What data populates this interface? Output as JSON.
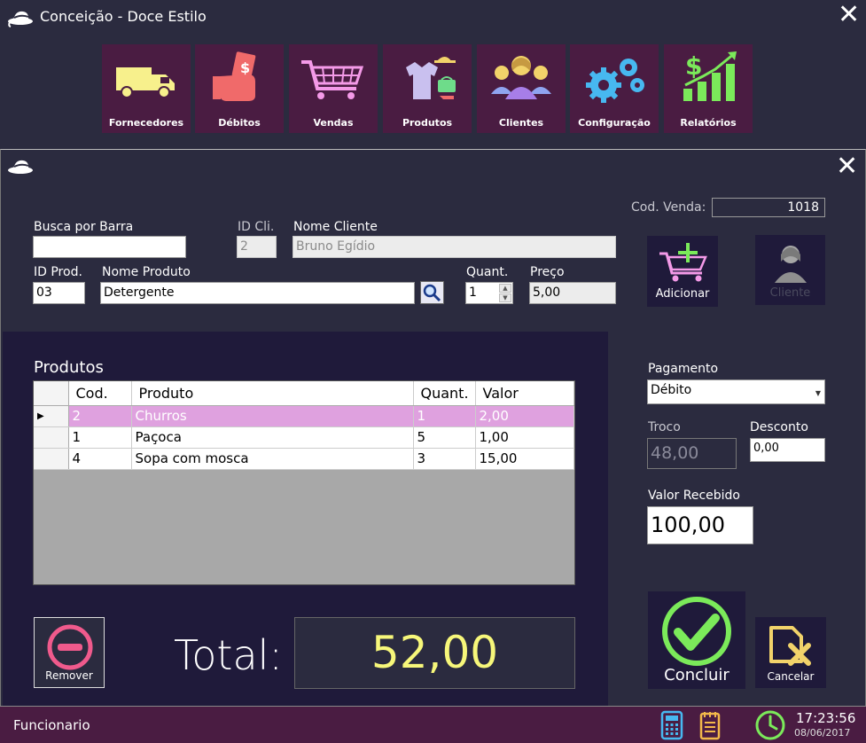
{
  "app": {
    "title": "Conceição - Doce Estilo"
  },
  "nav": [
    {
      "label": "Fornecedores",
      "icon": "truck-icon"
    },
    {
      "label": "Débitos",
      "icon": "money-hand-icon"
    },
    {
      "label": "Vendas",
      "icon": "cart-icon"
    },
    {
      "label": "Produtos",
      "icon": "clothes-icon"
    },
    {
      "label": "Clientes",
      "icon": "people-icon"
    },
    {
      "label": "Configuração",
      "icon": "gears-icon"
    },
    {
      "label": "Relatórios",
      "icon": "growth-chart-icon"
    }
  ],
  "form": {
    "cod_venda_label": "Cod. Venda:",
    "cod_venda": "1018",
    "busca_label": "Busca por Barra",
    "busca_value": "",
    "id_cli_label": "ID Cli.",
    "id_cli": "2",
    "nome_cliente_label": "Nome Cliente",
    "nome_cliente": "Bruno Egídio",
    "id_prod_label": "ID Prod.",
    "id_prod": "03",
    "nome_produto_label": "Nome Produto",
    "nome_produto": "Detergente",
    "quant_label": "Quant.",
    "quant": "1",
    "preco_label": "Preço",
    "preco": "5,00",
    "adicionar_label": "Adicionar",
    "cliente_label": "Cliente"
  },
  "produtos": {
    "title": "Produtos",
    "columns": [
      "Cod.",
      "Produto",
      "Quant.",
      "Valor"
    ],
    "rows": [
      {
        "cod": "2",
        "produto": "Churros",
        "quant": "1",
        "valor": "2,00"
      },
      {
        "cod": "1",
        "produto": "Paçoca",
        "quant": "5",
        "valor": "1,00"
      },
      {
        "cod": "4",
        "produto": "Sopa com mosca",
        "quant": "3",
        "valor": "15,00"
      }
    ]
  },
  "pagamento": {
    "label": "Pagamento",
    "value": "Débito",
    "troco_label": "Troco",
    "troco": "48,00",
    "desconto_label": "Desconto",
    "desconto": "0,00",
    "valor_recebido_label": "Valor Recebido",
    "valor_recebido": "100,00"
  },
  "total": {
    "label": "Total:",
    "value": "52,00"
  },
  "actions": {
    "remover": "Remover",
    "concluir": "Concluir",
    "cancelar": "Cancelar"
  },
  "status": {
    "user": "Funcionario",
    "time": "17:23:56",
    "date": "08/06/2017"
  },
  "colors": {
    "accent": "#4a1c42",
    "highlight": "#dfa1df",
    "total": "#f7f77a",
    "green": "#7bea5a"
  }
}
